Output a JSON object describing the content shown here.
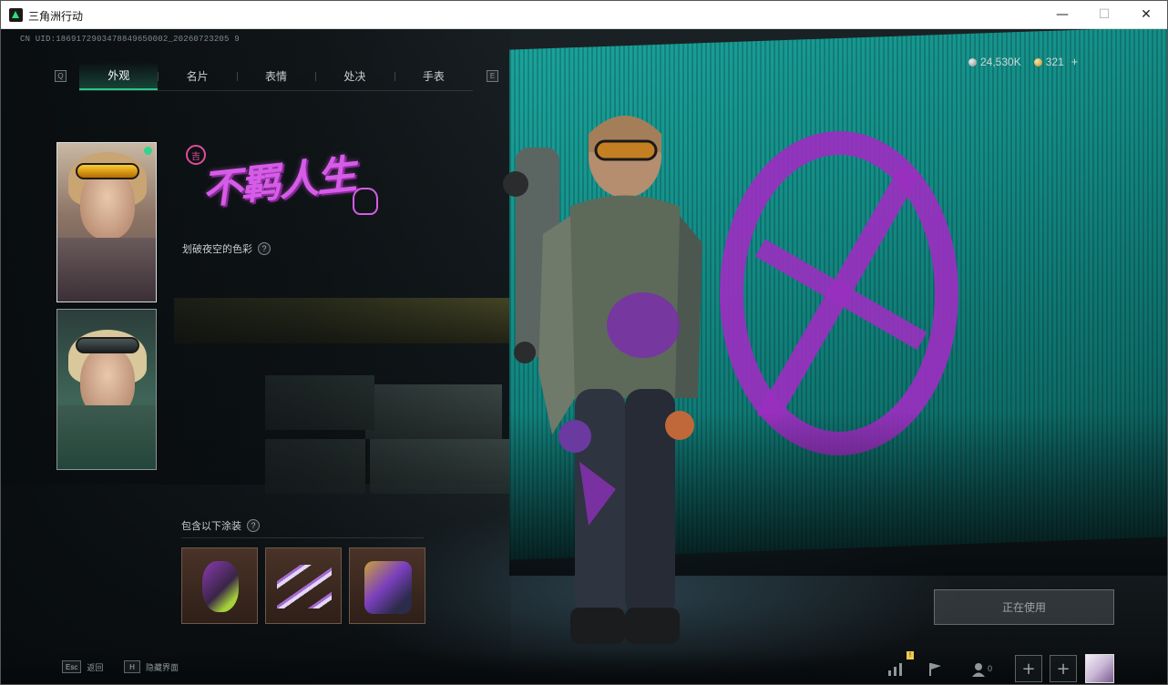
{
  "window": {
    "title": "三角洲行动",
    "minimize": "—",
    "maximize": "☐",
    "close": "✕"
  },
  "uid": "CN UID:1869172903478849650002_20260723205 9",
  "tabs": [
    {
      "label": "外观",
      "active": true
    },
    {
      "label": "名片",
      "active": false
    },
    {
      "label": "表情",
      "active": false
    },
    {
      "label": "处决",
      "active": false
    },
    {
      "label": "手表",
      "active": false
    }
  ],
  "tab_keys": {
    "prev": "Q",
    "next": "E"
  },
  "currency": {
    "silver": "24,530K",
    "gold": "321",
    "add": "+"
  },
  "skin": {
    "logo_text": "不羁人生",
    "logo_badge": "吉",
    "description": "划破夜空的色彩",
    "help": "?"
  },
  "paints": {
    "label": "包含以下涂装",
    "help": "?",
    "items": [
      {
        "name": "paint-1",
        "icon": "grenade-paint-icon"
      },
      {
        "name": "paint-2",
        "icon": "knife-paint-icon"
      },
      {
        "name": "paint-3",
        "icon": "backpack-paint-icon"
      }
    ]
  },
  "in_use_label": "正在使用",
  "hotkeys": [
    {
      "key": "Esc",
      "label": "返回"
    },
    {
      "key": "H",
      "label": "隐藏界面"
    }
  ],
  "bottom_icons": {
    "stats_badge": "!",
    "friends_count": "0",
    "plus": "+"
  },
  "colors": {
    "accent": "#29c58c",
    "graffiti": "#9a2fc0",
    "wall": "#17968f"
  }
}
